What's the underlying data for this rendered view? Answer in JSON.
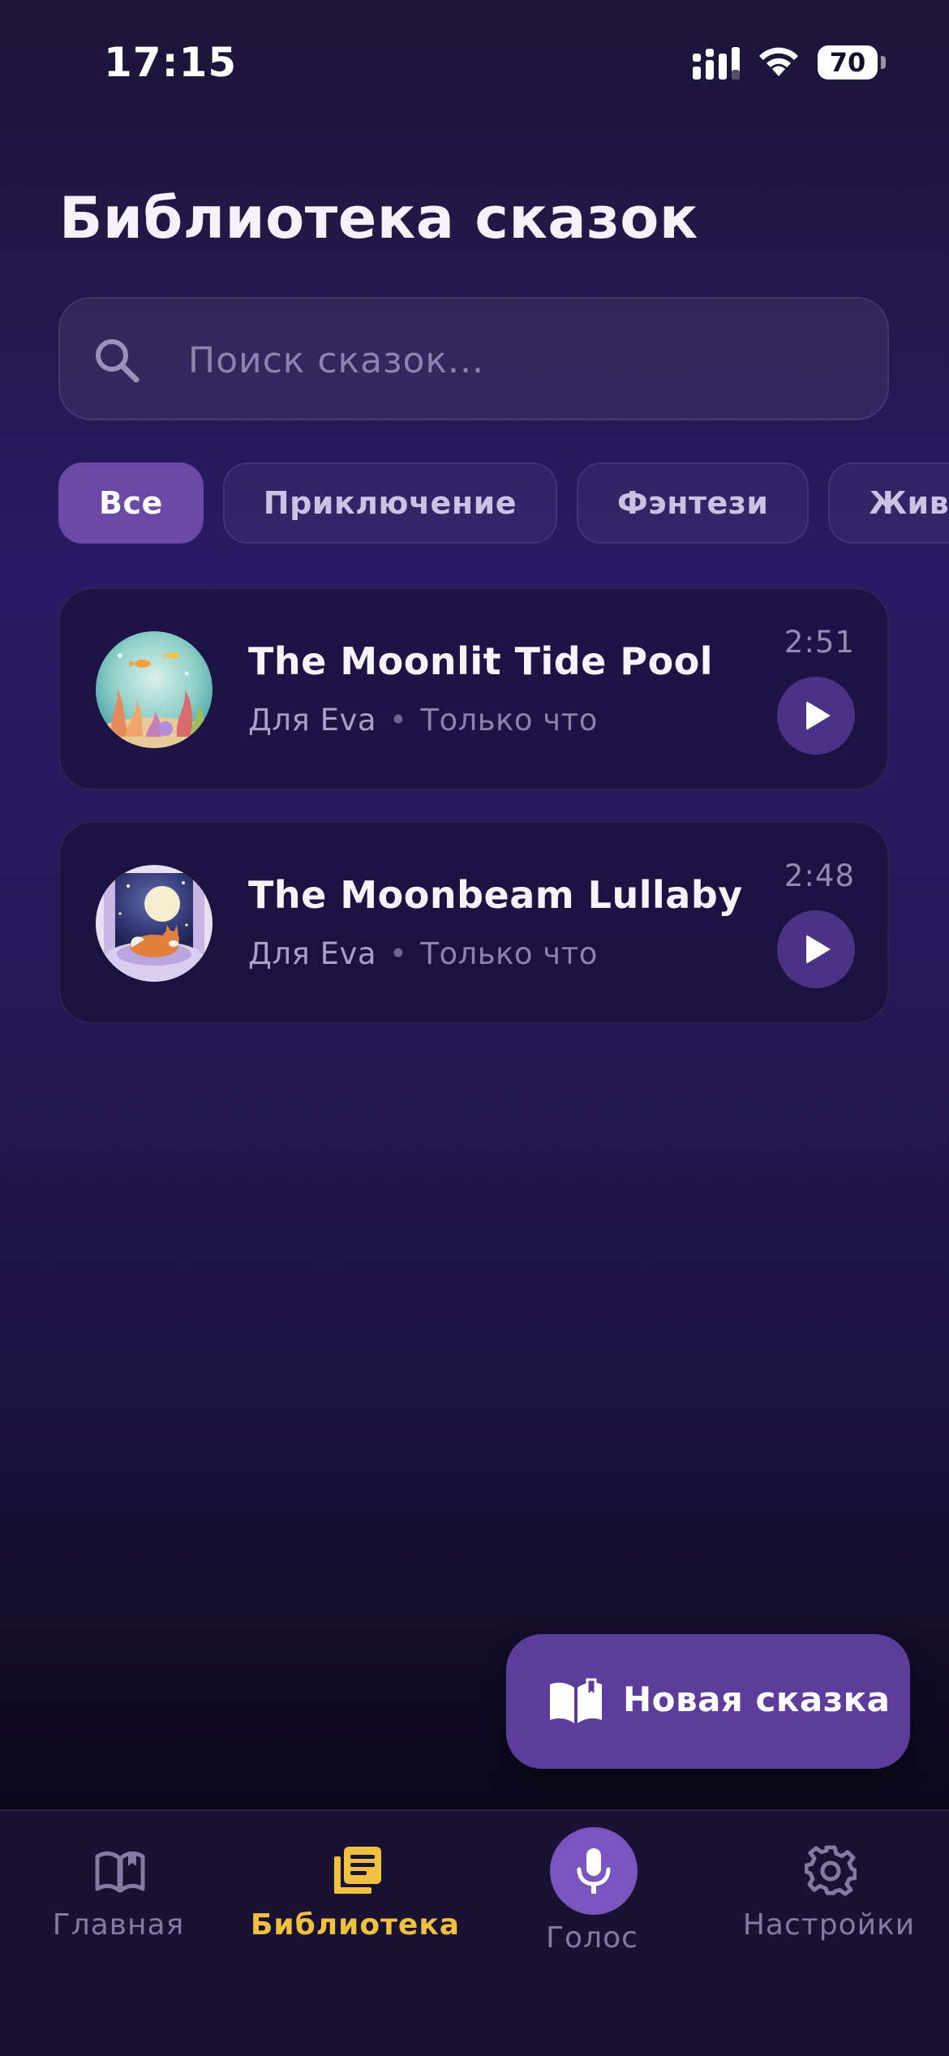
{
  "status_bar": {
    "time": "17:15",
    "battery": "70",
    "icons": [
      "signal-icon",
      "wifi-icon",
      "battery-icon"
    ]
  },
  "header": {
    "title": "Библиотека сказок"
  },
  "search": {
    "placeholder": "Поиск сказок...",
    "value": "",
    "icon": "search-icon"
  },
  "filters": {
    "items": [
      {
        "label": "Все",
        "active": true
      },
      {
        "label": "Приключение",
        "active": false
      },
      {
        "label": "Фэнтези",
        "active": false
      },
      {
        "label": "Животные",
        "active": false
      }
    ]
  },
  "stories": [
    {
      "title": "The Moonlit Tide Pool",
      "for": "Для Eva",
      "created": "Только что",
      "duration": "2:51",
      "thumbnail": "underwater-coral-illustration",
      "action_icon": "play-icon"
    },
    {
      "title": "The Moonbeam Lullaby",
      "for": "Для Eva",
      "created": "Только что",
      "duration": "2:48",
      "thumbnail": "sleeping-fox-moon-illustration",
      "action_icon": "play-icon"
    }
  ],
  "fab": {
    "label": "Новая сказка",
    "icon": "open-book-icon"
  },
  "bottom_nav": {
    "items": [
      {
        "label": "Главная",
        "icon": "open-book-icon",
        "active": false
      },
      {
        "label": "Библиотека",
        "icon": "library-icon",
        "active": true
      },
      {
        "label": "Голос",
        "icon": "microphone-icon",
        "active": false
      },
      {
        "label": "Настройки",
        "icon": "gear-icon",
        "active": false
      }
    ]
  },
  "colors": {
    "accent": "#6a4aa6",
    "active_nav": "#f0c040",
    "fab": "#5d3d9b",
    "play_button": "#4b3286"
  }
}
